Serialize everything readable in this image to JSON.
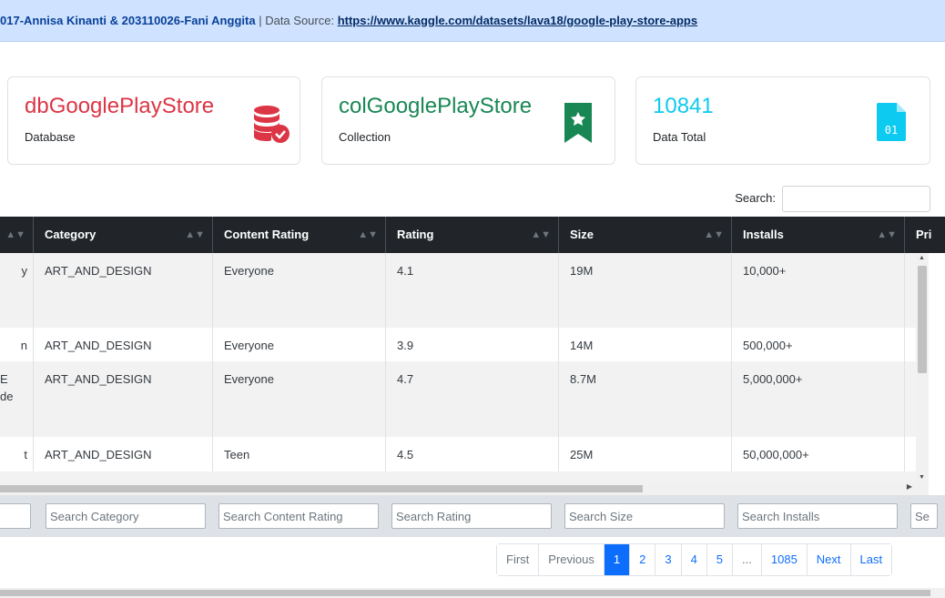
{
  "header": {
    "authors": "017-Annisa Kinanti & 203110026-Fani Anggita",
    "separator": "|",
    "source_label": "Data Source:",
    "source_link": "https://www.kaggle.com/datasets/lava18/google-play-store-apps"
  },
  "cards": {
    "database": {
      "value": "dbGooglePlayStore",
      "label": "Database",
      "color": "#dc3545",
      "icon": "database-check-icon"
    },
    "collection": {
      "value": "colGooglePlayStore",
      "label": "Collection",
      "color": "#198754",
      "icon": "bookmark-star-icon"
    },
    "total": {
      "value": "10841",
      "label": "Data Total",
      "color": "#0dcaf0",
      "icon": "binary-file-icon",
      "icon_text": "01"
    }
  },
  "search": {
    "label": "Search:",
    "value": ""
  },
  "table": {
    "columns": [
      "Category",
      "Content Rating",
      "Rating",
      "Size",
      "Installs",
      "Pri"
    ],
    "rows": [
      {
        "app": "y",
        "category": "ART_AND_DESIGN",
        "content_rating": "Everyone",
        "rating": "4.1",
        "size": "19M",
        "installs": "10,000+",
        "price": "("
      },
      {
        "app": "n",
        "category": "ART_AND_DESIGN",
        "content_rating": "Everyone",
        "rating": "3.9",
        "size": "14M",
        "installs": "500,000+",
        "price": "("
      },
      {
        "app": "E\nde",
        "category": "ART_AND_DESIGN",
        "content_rating": "Everyone",
        "rating": "4.7",
        "size": "8.7M",
        "installs": "5,000,000+",
        "price": "("
      },
      {
        "app": "t",
        "category": "ART_AND_DESIGN",
        "content_rating": "Teen",
        "rating": "4.5",
        "size": "25M",
        "installs": "50,000,000+",
        "price": "("
      }
    ],
    "filters": [
      "",
      "Search Category",
      "Search Content Rating",
      "Search Rating",
      "Search Size",
      "Search Installs",
      "Se"
    ]
  },
  "pagination": {
    "first": "First",
    "previous": "Previous",
    "pages": [
      "1",
      "2",
      "3",
      "4",
      "5"
    ],
    "ellipsis": "...",
    "last_page": "1085",
    "next": "Next",
    "last": "Last",
    "active": "1"
  }
}
